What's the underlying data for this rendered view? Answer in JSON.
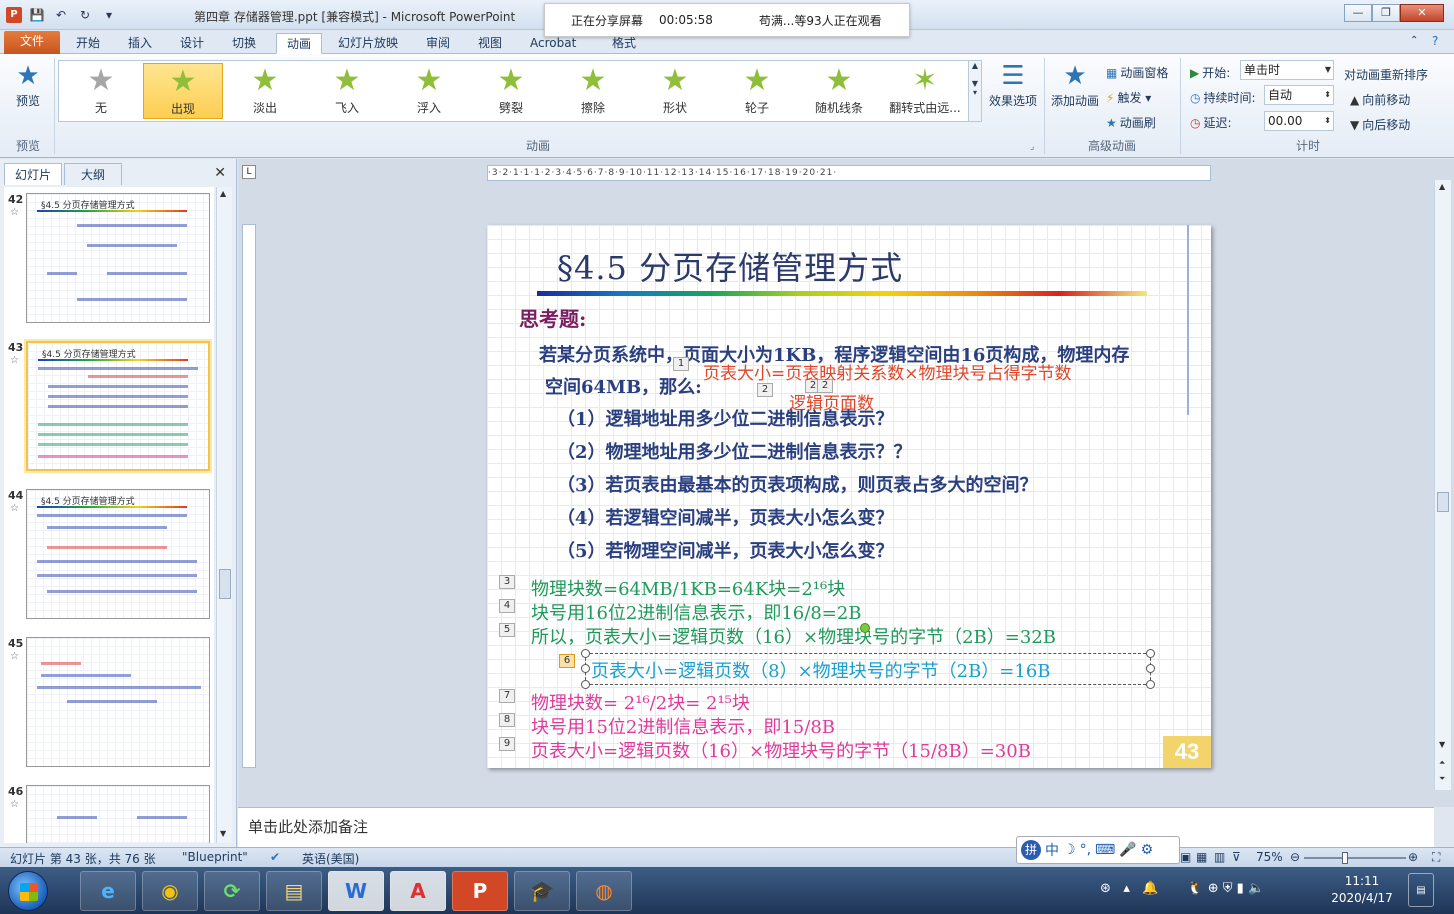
{
  "window": {
    "title": "第四章 存储器管理.ppt [兼容模式] - Microsoft PowerPoint",
    "app_icon": "P",
    "share_banner": {
      "status": "正在分享屏幕",
      "time": "00:05:58",
      "viewers": "苟满...等93人正在观看"
    }
  },
  "tabs": [
    "文件",
    "开始",
    "插入",
    "设计",
    "切换",
    "动画",
    "幻灯片放映",
    "审阅",
    "视图",
    "Acrobat",
    "格式"
  ],
  "ribbon": {
    "preview": {
      "label": "预览",
      "group": "预览"
    },
    "animations": [
      {
        "label": "无"
      },
      {
        "label": "出现"
      },
      {
        "label": "淡出"
      },
      {
        "label": "飞入"
      },
      {
        "label": "浮入"
      },
      {
        "label": "劈裂"
      },
      {
        "label": "擦除"
      },
      {
        "label": "形状"
      },
      {
        "label": "轮子"
      },
      {
        "label": "随机线条"
      },
      {
        "label": "翻转式由远..."
      }
    ],
    "animation_group": "动画",
    "effect_options": "效果选项",
    "add_animation": "添加动画",
    "anim_pane": "动画窗格",
    "trigger": "触发",
    "anim_painter": "动画刷",
    "advanced_group": "高级动画",
    "start_label": "开始:",
    "start_value": "单击时",
    "duration_label": "持续时间:",
    "duration_value": "自动",
    "delay_label": "延迟:",
    "delay_value": "00.00",
    "reorder_title": "对动画重新排序",
    "move_earlier": "向前移动",
    "move_later": "向后移动",
    "timing_group": "计时"
  },
  "left_panel": {
    "tab_slides": "幻灯片",
    "tab_outline": "大纲",
    "thumbs": [
      {
        "num": "42",
        "title": "§4.5 分页存储管理方式"
      },
      {
        "num": "43",
        "title": "§4.5 分页存储管理方式"
      },
      {
        "num": "44",
        "title": "§4.5 分页存储管理方式"
      },
      {
        "num": "45",
        "title": ""
      },
      {
        "num": "46",
        "title": ""
      }
    ]
  },
  "ruler": {
    "top": "·3·2·1·1·1·2·3·4·5·6·7·8·9·10·11·12·13·14·15·16·17·18·19·20·21·",
    "corner": "L"
  },
  "slide": {
    "title": "§4.5  分页存储管理方式",
    "question_head": "思考题:",
    "intro_line1": "若某分页系统中，页面大小为1KB，程序逻辑空间由16页构成，物理内存",
    "intro_line2": "空间64MB，那么:",
    "red_annotation1": "页表大小=页表映射关系数×物理块号占得字节数",
    "red_annotation2": "逻辑页面数",
    "questions": [
      "（1）逻辑地址用多少位二进制信息表示？",
      "（2）物理地址用多少位二进制信息表示？？",
      "（3）若页表由最基本的页表项构成，则页表占多大的空间？",
      "（4）若逻辑空间减半，页表大小怎么变？",
      "（5）若物理空间减半，页表大小怎么变？"
    ],
    "tags": [
      "1",
      "2",
      "2",
      "2",
      "3",
      "4",
      "5",
      "6",
      "7",
      "8",
      "9"
    ],
    "answers_green": [
      "物理块数=64MB/1KB=64K块=2¹⁶块",
      "块号用16位2进制信息表示，即16/8=2B",
      "所以，页表大小=逻辑页数（16）×物理块号的字节（2B）=32B"
    ],
    "answer_cyan": "页表大小=逻辑页数（8）×物理块号的字节（2B）=16B",
    "answers_pink": [
      "物理块数= 2¹⁶/2块= 2¹⁵块",
      "块号用15位2进制信息表示，即15/8B",
      "页表大小=逻辑页数（16）×物理块号的字节（15/8B）=30B"
    ],
    "page_number": "43"
  },
  "notes_placeholder": "单击此处添加备注",
  "status": {
    "slide_info": "幻灯片 第 43 张，共 76 张",
    "theme": "\"Blueprint\"",
    "language": "英语(美国)",
    "zoom": "75%"
  },
  "ime": {
    "lang": "中",
    "logo": "拼"
  },
  "taskbar": {
    "apps": [
      {
        "name": "ie",
        "label": "e"
      },
      {
        "name": "chrome",
        "label": "◉"
      },
      {
        "name": "refresh",
        "label": "⟳"
      },
      {
        "name": "explorer",
        "label": "▤"
      },
      {
        "name": "word",
        "label": "W"
      },
      {
        "name": "acrobat",
        "label": "A"
      },
      {
        "name": "powerpoint",
        "label": "P"
      },
      {
        "name": "graduation",
        "label": "🎓"
      },
      {
        "name": "firefox",
        "label": "◍"
      }
    ],
    "clock_time": "11:11",
    "clock_date": "2020/4/17"
  },
  "colors": {
    "accent": "#c55520",
    "title_color": "#2c3a6b",
    "question_color": "#2a3f7f",
    "green": "#1e9a5a",
    "cyan": "#1a9fcf",
    "pink": "#e03a9d",
    "red": "#e0462a"
  }
}
